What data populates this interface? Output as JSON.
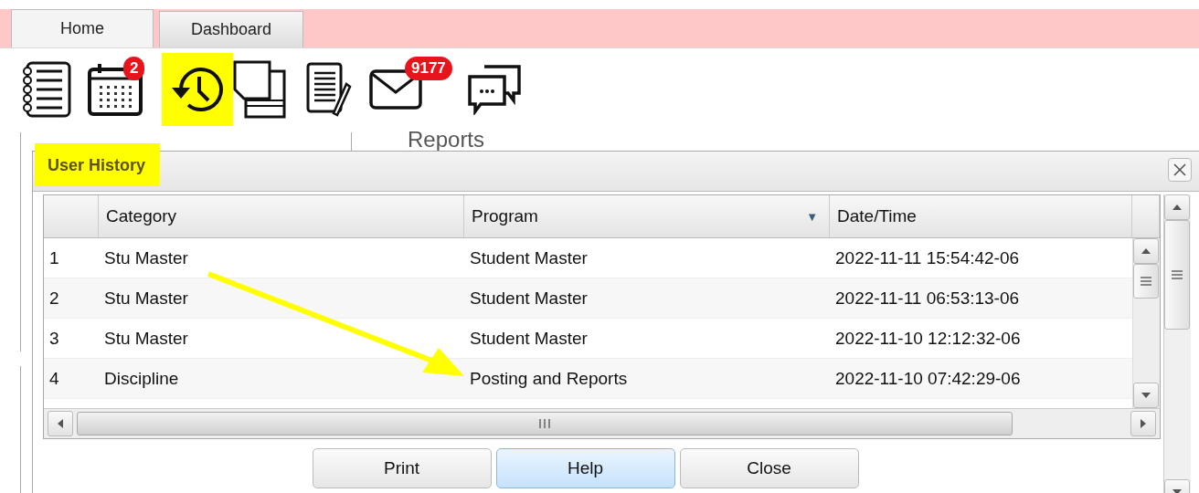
{
  "tabs": [
    {
      "label": "Home",
      "selected": true
    },
    {
      "label": "Dashboard",
      "selected": false
    }
  ],
  "toolbar": [
    {
      "kind": "notebook",
      "highlighted": false
    },
    {
      "kind": "calendar",
      "badge": "2",
      "highlighted": false
    },
    {
      "kind": "history",
      "highlighted": true
    },
    {
      "kind": "pages",
      "highlighted": false
    },
    {
      "kind": "notepad",
      "highlighted": false
    },
    {
      "kind": "mail",
      "badge": "9177",
      "highlighted": false
    },
    {
      "kind": "chat",
      "highlighted": false
    }
  ],
  "background_panel": {
    "heading": "Reports"
  },
  "dialog": {
    "title": "User History",
    "title_highlighted": true,
    "table": {
      "columns": [
        {
          "label": "Category"
        },
        {
          "label": "Program",
          "sort_icon": "▼"
        },
        {
          "label": "Date/Time"
        }
      ],
      "rows": [
        {
          "number": "1",
          "cells": [
            "Stu Master",
            "Student Master",
            "2022-11-11 15:54:42-06"
          ]
        },
        {
          "number": "2",
          "cells": [
            "Stu Master",
            "Student Master",
            "2022-11-11 06:53:13-06"
          ]
        },
        {
          "number": "3",
          "cells": [
            "Stu Master",
            "Student Master",
            "2022-11-10 12:12:32-06"
          ]
        },
        {
          "number": "4",
          "cells": [
            "Discipline",
            "Posting and Reports",
            "2022-11-10 07:42:29-06"
          ]
        }
      ]
    },
    "buttons": [
      {
        "label": "Print",
        "selected": false
      },
      {
        "label": "Help",
        "selected": true
      },
      {
        "label": "Close",
        "selected": false
      }
    ]
  }
}
